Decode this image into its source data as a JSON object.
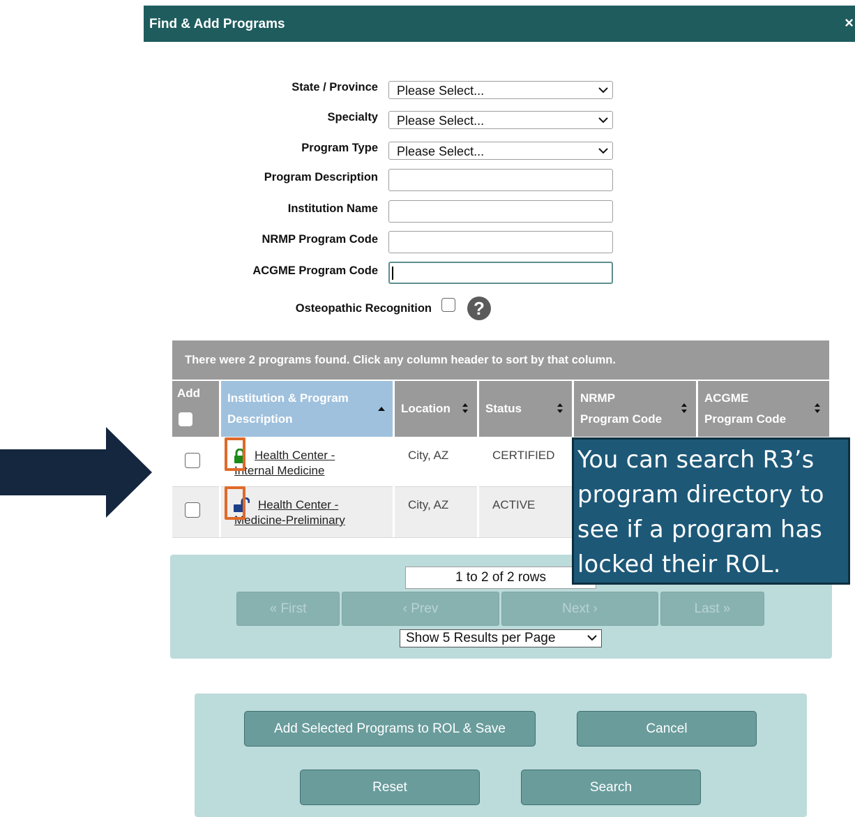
{
  "dialog": {
    "title": "Find & Add Programs",
    "close_glyph": "×"
  },
  "form": {
    "state_label": "State / Province",
    "state_value": "Please Select...",
    "specialty_label": "Specialty",
    "specialty_value": "Please Select...",
    "program_type_label": "Program Type",
    "program_type_value": "Please Select...",
    "program_description_label": "Program Description",
    "program_description_value": "",
    "institution_name_label": "Institution Name",
    "institution_name_value": "",
    "nrmp_code_label": "NRMP Program Code",
    "nrmp_code_value": "",
    "acgme_code_label": "ACGME Program Code",
    "acgme_code_value": "",
    "osteopathic_label": "Osteopathic Recognition",
    "osteopathic_checked": false,
    "help_glyph": "?"
  },
  "results": {
    "summary": "There were 2 programs found. Click any column header to sort by that column.",
    "columns": {
      "add": "Add",
      "institution_line1": "Institution & Program",
      "institution_line2": "Description",
      "location": "Location",
      "status": "Status",
      "nrmp_line1": "NRMP",
      "nrmp_line2": "Program Code",
      "acgme_line1": "ACGME",
      "acgme_line2": "Program Code"
    },
    "rows": [
      {
        "name_line1": "Health Center -",
        "name_line2": "Internal Medicine",
        "location": "City, AZ",
        "status": "CERTIFIED",
        "lock": "locked",
        "lock_color": "#1a8a1a"
      },
      {
        "name_line1": "Health Center -",
        "name_line2": "Medicine-Preliminary",
        "location": "City, AZ",
        "status": "ACTIVE",
        "lock": "unlocked",
        "lock_color": "#1d3f8a"
      }
    ]
  },
  "pagination": {
    "rows_info": "1 to 2 of 2 rows",
    "first": "« First",
    "prev": "‹ Prev",
    "next": "Next ›",
    "last": "Last »",
    "per_page": "Show 5 Results per Page"
  },
  "actions": {
    "add_save": "Add Selected Programs to ROL & Save",
    "cancel": "Cancel",
    "reset": "Reset",
    "search": "Search"
  },
  "callout": {
    "line1": "You can search R3’s",
    "line2": "program directory to",
    "line3": "see if a program has",
    "line4": "locked their ROL."
  },
  "colors": {
    "header_bar": "#1e5c5e",
    "callout_bg": "#1d5877",
    "highlight_box": "#e06a2a",
    "arrow": "#15263f",
    "panel_bg": "#bcdbdb"
  }
}
